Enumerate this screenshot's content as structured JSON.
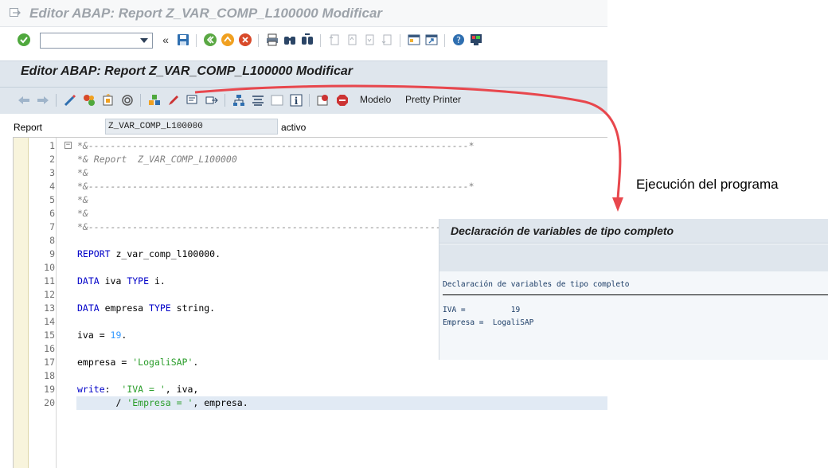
{
  "window": {
    "title": "Editor ABAP: Report Z_VAR_COMP_L100000 Modificar"
  },
  "system_toolbar": {
    "command_field_value": "",
    "icons": [
      "enter-icon",
      "save-icon",
      "back-icon",
      "exit-icon",
      "cancel-icon",
      "print-icon",
      "find-icon",
      "find-next-icon",
      "first-page-icon",
      "previous-page-icon",
      "next-page-icon",
      "last-page-icon",
      "create-session-icon",
      "shortcut-icon",
      "help-icon",
      "customize-layout-icon"
    ]
  },
  "screen": {
    "title": "Editor ABAP: Report Z_VAR_COMP_L100000 Modificar"
  },
  "app_toolbar": {
    "modelo_label": "Modelo",
    "pretty_printer_label": "Pretty Printer"
  },
  "report": {
    "label": "Report",
    "value": "Z_VAR_COMP_L100000",
    "status": "activo"
  },
  "code": {
    "line_numbers": [
      "1",
      "2",
      "3",
      "4",
      "5",
      "6",
      "7",
      "8",
      "9",
      "10",
      "11",
      "12",
      "13",
      "14",
      "15",
      "16",
      "17",
      "18",
      "19",
      "20"
    ],
    "lines": [
      "*&---------------------------------------------------------------------*",
      "*& Report  Z_VAR_COMP_L100000",
      "*&",
      "*&---------------------------------------------------------------------*",
      "*&",
      "*&",
      "*&---------------------------------------------------------------------*",
      "",
      "REPORT z_var_comp_l100000.",
      "",
      "DATA iva TYPE i.",
      "",
      "DATA empresa TYPE string.",
      "",
      "iva = 19.",
      "",
      "empresa = 'LogaliSAP'.",
      "",
      "write:  'IVA = ', iva,",
      "       / 'Empresa = ', empresa."
    ]
  },
  "annotation": {
    "label": "Ejecución del programa",
    "arrow_color": "#e8474d"
  },
  "output": {
    "title": "Declaración de variables de tipo completo",
    "heading": "Declaración de variables de tipo completo",
    "line1": "IVA =          19",
    "line2": "Empresa =  LogaliSAP"
  }
}
